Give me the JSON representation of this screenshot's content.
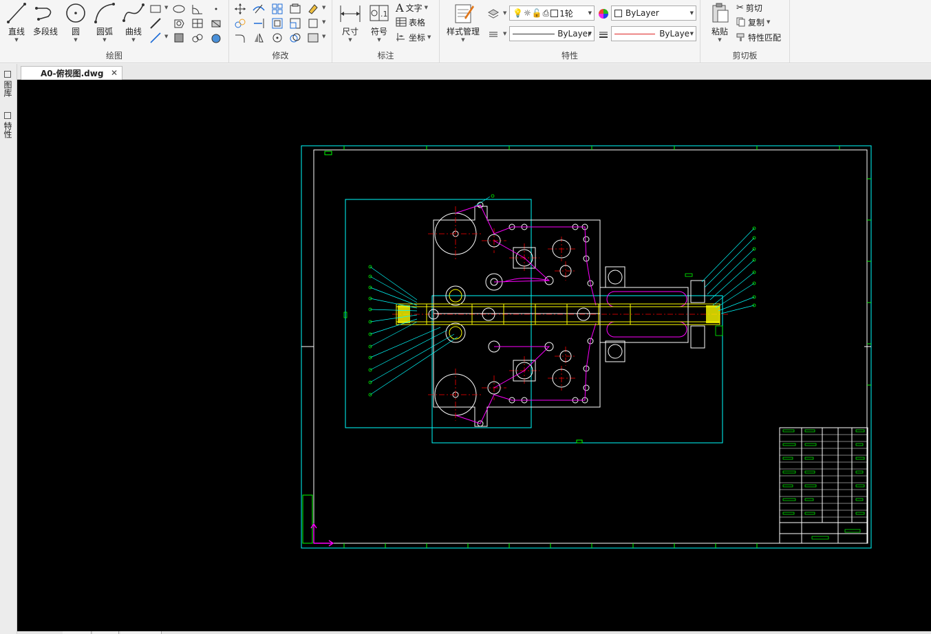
{
  "ribbon": {
    "panels": {
      "draw": {
        "title": "绘图",
        "tools": {
          "line": "直线",
          "polyline": "多段线",
          "circle": "圆",
          "arc": "圆弧",
          "spline": "曲线"
        }
      },
      "modify": {
        "title": "修改"
      },
      "annotate": {
        "title": "标注",
        "tools": {
          "dimension": "尺寸",
          "symbol": "符号",
          "text": "文字",
          "table": "表格",
          "coordinate": "坐标"
        }
      },
      "properties": {
        "title": "特性",
        "style_manager": "样式管理",
        "layer_value": "1轮",
        "color_value": "ByLayer",
        "linetype_value": "ByLayer",
        "lineweight_value": "ByLayer"
      },
      "clipboard": {
        "title": "剪切板",
        "paste": "粘贴",
        "cut": "剪切",
        "copy": "复制",
        "match_properties": "特性匹配"
      }
    }
  },
  "document_tab": {
    "label": "A0-俯视图.dwg",
    "close": "✕"
  },
  "side_palette": {
    "tab1": "图库",
    "tab2": "特性"
  },
  "colors": {
    "canvas": "#000000",
    "frame": "#00ffff",
    "geometry": "#ffffff",
    "dimension": "#00ff00",
    "hidden": "#ff00ff",
    "center": "#ff0000",
    "highlight": "#ffff00"
  }
}
